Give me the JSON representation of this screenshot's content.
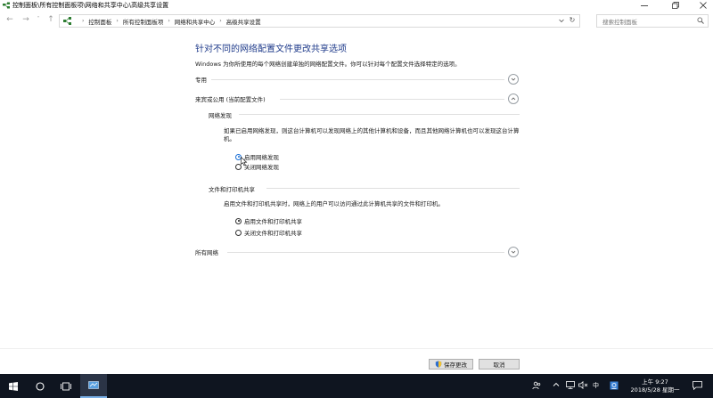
{
  "window": {
    "title": "控制面板\\所有控制面板项\\网络和共享中心\\高级共享设置"
  },
  "addressbar": {
    "crumbs": [
      "控制面板",
      "所有控制面板项",
      "网络和共享中心",
      "高级共享设置"
    ],
    "search_placeholder": "搜索控制面板"
  },
  "page": {
    "heading": "针对不同的网络配置文件更改共享选项",
    "description": "Windows 为你所使用的每个网络创建单独的网络配置文件。你可以针对每个配置文件选择特定的选项。",
    "sections": {
      "private": {
        "label": "专用",
        "expanded": false
      },
      "guest": {
        "label": "来宾或公用 (当前配置文件)",
        "expanded": true,
        "discovery": {
          "title": "网络发现",
          "text": "如果已启用网络发现，则这台计算机可以发现网络上的其他计算机和设备，而且其他网络计算机也可以发现这台计算机。",
          "options": [
            "启用网络发现",
            "关闭网络发现"
          ],
          "selected": 0
        },
        "file_sharing": {
          "title": "文件和打印机共享",
          "text": "启用文件和打印机共享时，网络上的用户可以访问通过此计算机共享的文件和打印机。",
          "options": [
            "启用文件和打印机共享",
            "关闭文件和打印机共享"
          ],
          "selected": 0
        }
      },
      "all": {
        "label": "所有网络",
        "expanded": false
      }
    }
  },
  "footer": {
    "save_label": "保存更改",
    "cancel_label": "取消"
  },
  "taskbar": {
    "ime": "中",
    "time": "上午 9:27",
    "date": "2018/5/28 星期一"
  },
  "colors": {
    "heading": "#1e3a8a",
    "taskbar": "#0f1520",
    "accent": "#1a6fd6"
  }
}
